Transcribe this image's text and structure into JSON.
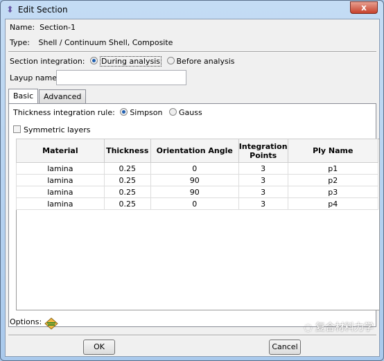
{
  "window": {
    "title": "Edit Section",
    "close_label": "x"
  },
  "name": {
    "label": "Name:",
    "value": "Section-1"
  },
  "type": {
    "label": "Type:",
    "value": "Shell / Continuum Shell, Composite"
  },
  "section_integration": {
    "label": "Section integration:",
    "options": [
      {
        "label": "During analysis",
        "selected": true
      },
      {
        "label": "Before analysis",
        "selected": false
      }
    ]
  },
  "layup": {
    "label": "Layup name:",
    "value": "",
    "placeholder": ""
  },
  "tabs": [
    {
      "label": "Basic",
      "active": true
    },
    {
      "label": "Advanced",
      "active": false
    }
  ],
  "thickness_rule": {
    "label": "Thickness integration rule:",
    "options": [
      {
        "label": "Simpson",
        "selected": true
      },
      {
        "label": "Gauss",
        "selected": false
      }
    ]
  },
  "symmetric": {
    "label": "Symmetric layers",
    "checked": false
  },
  "table": {
    "headers": [
      "Material",
      "Thickness",
      "Orientation Angle",
      "Integration Points",
      "Ply Name"
    ],
    "rows": [
      [
        "lamina",
        "0.25",
        "0",
        "3",
        "p1"
      ],
      [
        "lamina",
        "0.25",
        "90",
        "3",
        "p2"
      ],
      [
        "lamina",
        "0.25",
        "90",
        "3",
        "p3"
      ],
      [
        "lamina",
        "0.25",
        "0",
        "3",
        "p4"
      ]
    ]
  },
  "options": {
    "label": "Options:",
    "icon": "layers-diamond-icon"
  },
  "buttons": {
    "ok": "OK",
    "cancel": "Cancel"
  },
  "watermark": "复合材料力学"
}
